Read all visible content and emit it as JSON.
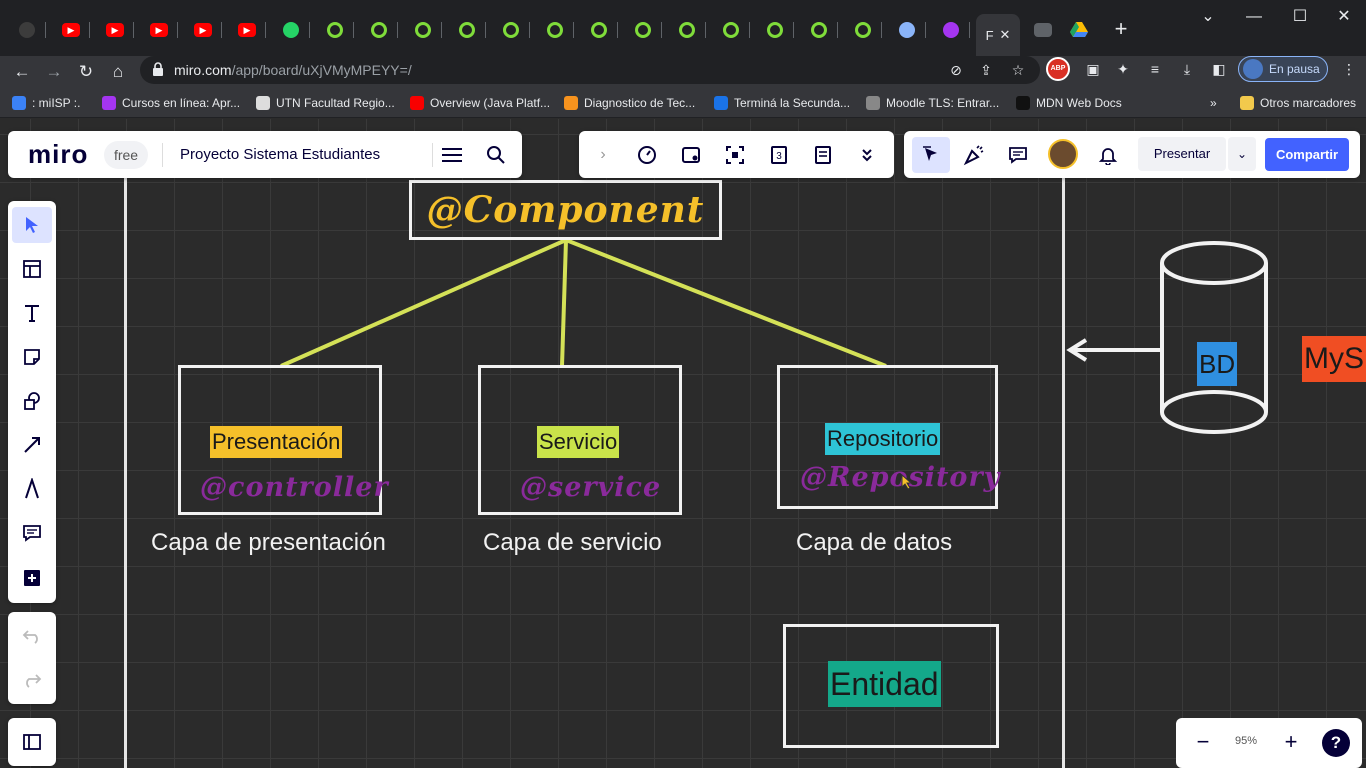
{
  "browser": {
    "tabs": [
      {
        "type": "github-icon"
      },
      {
        "type": "youtube-icon"
      },
      {
        "type": "youtube-icon"
      },
      {
        "type": "youtube-icon"
      },
      {
        "type": "youtube-icon"
      },
      {
        "type": "youtube-icon"
      },
      {
        "type": "whatsapp-icon"
      },
      {
        "type": "green-g-icon"
      },
      {
        "type": "green-g-icon"
      },
      {
        "type": "green-g-icon"
      },
      {
        "type": "green-g-icon"
      },
      {
        "type": "green-g-icon"
      },
      {
        "type": "green-g-icon"
      },
      {
        "type": "green-g-icon"
      },
      {
        "type": "green-g-icon"
      },
      {
        "type": "green-g-icon"
      },
      {
        "type": "green-g-icon"
      },
      {
        "type": "green-g-icon"
      },
      {
        "type": "green-g-icon"
      },
      {
        "type": "green-g-icon"
      },
      {
        "type": "globe-icon"
      },
      {
        "type": "udemy-icon"
      }
    ],
    "active_tab_label": "F",
    "url_host": "miro.com",
    "url_path": "/app/board/uXjVMyMPEYY=/",
    "profile_status": "En pausa",
    "bookmarks": [
      {
        "label": ": miISP :.",
        "color": "#3b82f6"
      },
      {
        "label": "Cursos en línea: Apr...",
        "color": "#a435f0"
      },
      {
        "label": "UTN Facultad Regio...",
        "color": "#dddddd"
      },
      {
        "label": "Overview (Java Platf...",
        "color": "#f80000"
      },
      {
        "label": "Diagnostico de Tec...",
        "color": "#f7931e"
      },
      {
        "label": "Terminá la Secunda...",
        "color": "#1a73e8"
      },
      {
        "label": "Moodle TLS: Entrar...",
        "color": "#888888"
      },
      {
        "label": "MDN Web Docs",
        "color": "#111111"
      }
    ],
    "bookmarks_overflow": "»",
    "other_bookmarks": "Otros marcadores"
  },
  "miro": {
    "logo": "miro",
    "plan": "free",
    "board_name": "Proyecto Sistema Estudiantes",
    "present_label": "Presentar",
    "share_label": "Compartir",
    "zoom_level": "95%"
  },
  "board": {
    "title": "@Component",
    "boxes": [
      {
        "tag": "Presentación",
        "tag_color": "#f5c02a",
        "annotation": "@controller",
        "caption": "Capa de presentación"
      },
      {
        "tag": "Servicio",
        "tag_color": "#c9e34a",
        "annotation": "@service",
        "caption": "Capa de servicio"
      },
      {
        "tag": "Repositorio",
        "tag_color": "#2ec4d6",
        "annotation": "@Repository",
        "caption": "Capa de datos"
      }
    ],
    "entity": {
      "label": "Entidad",
      "color": "#14a88a"
    },
    "db": {
      "label": "BD",
      "color": "#2f8fe0"
    },
    "mysql": {
      "label": "MyS",
      "color": "#f04e23"
    }
  }
}
